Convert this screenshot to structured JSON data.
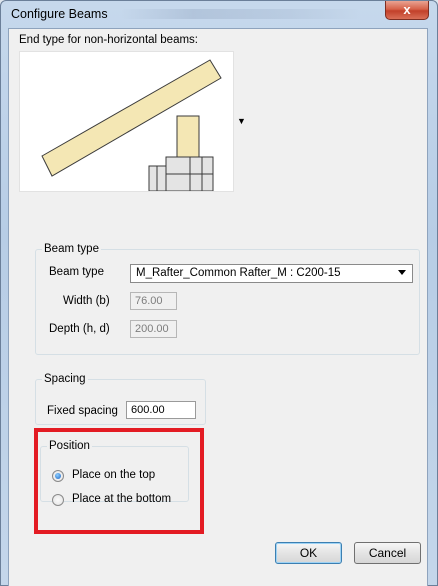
{
  "window": {
    "title": "Configure Beams",
    "close_glyph": "x"
  },
  "end_type": {
    "label": "End type for non-horizontal beams:",
    "dropdown_icon": "triangle-down"
  },
  "beam_type_group": {
    "legend": "Beam type",
    "beam_type_label": "Beam type",
    "beam_type_value": "M_Rafter_Common Rafter_M : C200-15",
    "width_label": "Width (b)",
    "width_value": "76.00",
    "depth_label": "Depth (h, d)",
    "depth_value": "200.00"
  },
  "spacing_group": {
    "legend": "Spacing",
    "fixed_spacing_label": "Fixed spacing",
    "fixed_spacing_value": "600.00"
  },
  "position_group": {
    "legend": "Position",
    "options": [
      {
        "label": "Place on the top",
        "checked": true
      },
      {
        "label": "Place at the bottom",
        "checked": false
      }
    ],
    "highlight_color": "#e31b23"
  },
  "buttons": {
    "ok": "OK",
    "cancel": "Cancel"
  }
}
